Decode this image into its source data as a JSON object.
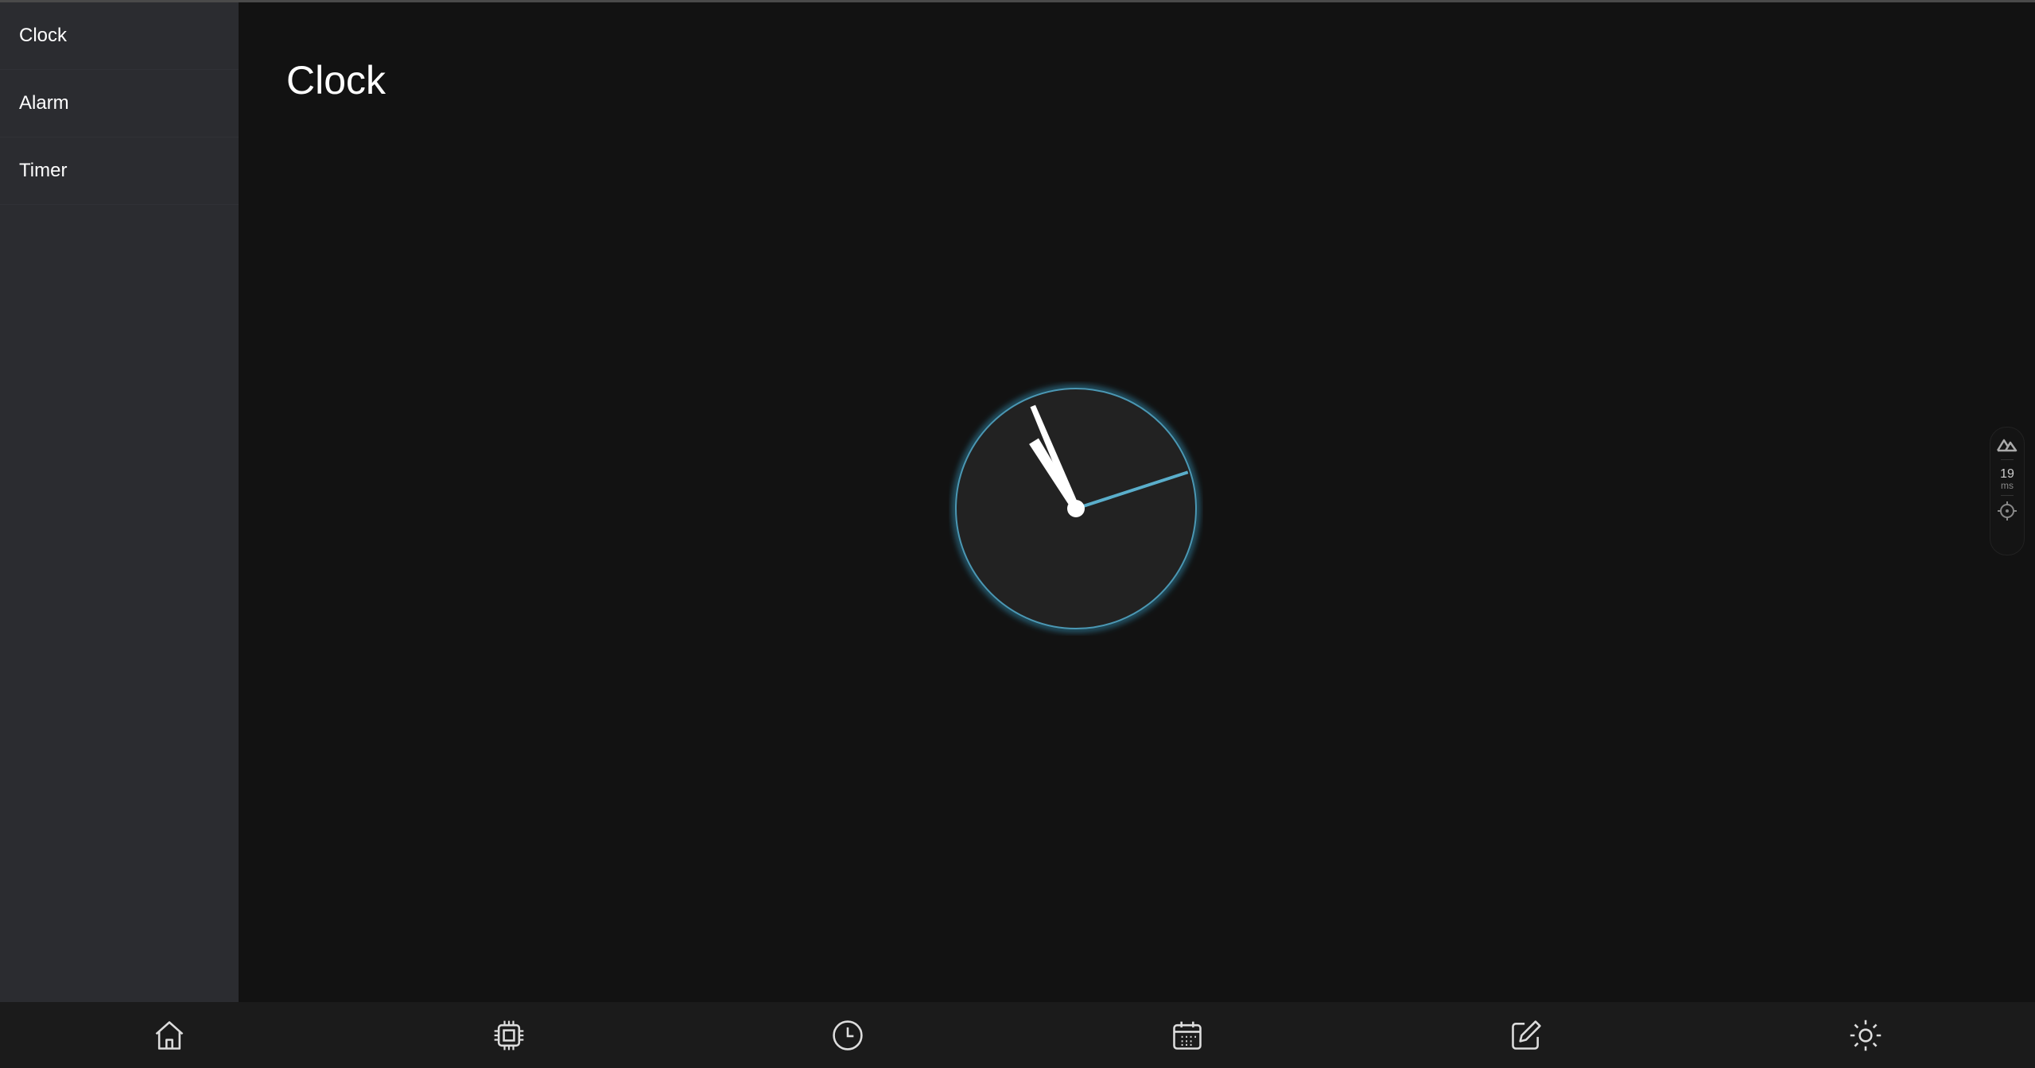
{
  "sidebar": {
    "items": [
      {
        "label": "Clock"
      },
      {
        "label": "Alarm"
      },
      {
        "label": "Timer"
      }
    ]
  },
  "main": {
    "title": "Clock"
  },
  "clock": {
    "hours": 10,
    "minutes": 56,
    "seconds": 12,
    "accent_color": "#5aaecb"
  },
  "devtools": {
    "render_time": "19",
    "render_unit": "ms"
  },
  "bottom_nav": {
    "items": [
      "home-icon",
      "chip-icon",
      "clock-icon",
      "calendar-icon",
      "edit-icon",
      "brightness-icon"
    ]
  }
}
